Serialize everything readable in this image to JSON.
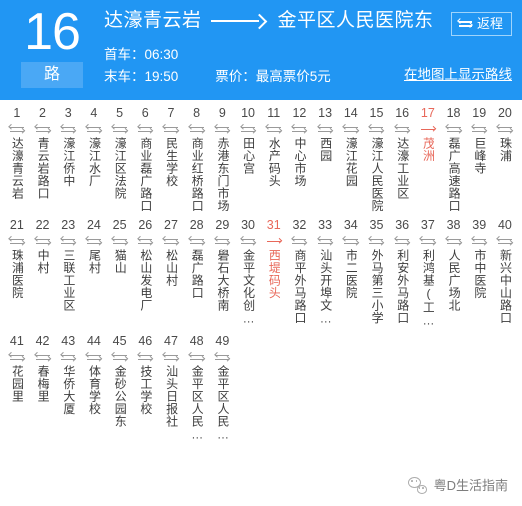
{
  "header": {
    "route_number": "16",
    "route_suffix": "路",
    "origin": "达濠青云岩",
    "destination": "金平区人民医院东",
    "direction_arrow_icon": "long-right-arrow-icon",
    "return_button_label": "返程",
    "return_button_icon": "swap-direction-icon",
    "first_bus_label": "首车：06:30",
    "last_bus_label": "末车：19:50",
    "fare_label": "票价：最高票价5元",
    "map_link_label": "在地图上显示路线",
    "background_color": "#2196f3",
    "badge_color": "#4aa8f5"
  },
  "highlight_color": "#e8685a",
  "stops": [
    {
      "num": "1",
      "name": "达濠青云岩",
      "highlight": false
    },
    {
      "num": "2",
      "name": "青云岩路口",
      "highlight": false
    },
    {
      "num": "3",
      "name": "濠江侨中",
      "highlight": false
    },
    {
      "num": "4",
      "name": "濠江水厂",
      "highlight": false
    },
    {
      "num": "5",
      "name": "濠江区法院",
      "highlight": false
    },
    {
      "num": "6",
      "name": "商业磊广路口",
      "highlight": false
    },
    {
      "num": "7",
      "name": "民生学校",
      "highlight": false
    },
    {
      "num": "8",
      "name": "商业红桥路口",
      "highlight": false
    },
    {
      "num": "9",
      "name": "赤港东门市场",
      "highlight": false
    },
    {
      "num": "10",
      "name": "田心宫",
      "highlight": false
    },
    {
      "num": "11",
      "name": "水产码头",
      "highlight": false
    },
    {
      "num": "12",
      "name": "中心市场",
      "highlight": false
    },
    {
      "num": "13",
      "name": "西园",
      "highlight": false
    },
    {
      "num": "14",
      "name": "濠江花园",
      "highlight": false
    },
    {
      "num": "15",
      "name": "濠江人民医院",
      "highlight": false
    },
    {
      "num": "16",
      "name": "达濠工业区",
      "highlight": false
    },
    {
      "num": "17",
      "name": "茂洲",
      "highlight": true
    },
    {
      "num": "18",
      "name": "磊广高速路口",
      "highlight": false
    },
    {
      "num": "19",
      "name": "巨峰寺",
      "highlight": false
    },
    {
      "num": "20",
      "name": "珠浦",
      "highlight": false
    },
    {
      "num": "21",
      "name": "珠浦医院",
      "highlight": false
    },
    {
      "num": "22",
      "name": "中村",
      "highlight": false
    },
    {
      "num": "23",
      "name": "三联工业区",
      "highlight": false
    },
    {
      "num": "24",
      "name": "尾村",
      "highlight": false
    },
    {
      "num": "25",
      "name": "猫山",
      "highlight": false
    },
    {
      "num": "26",
      "name": "松山发电厂",
      "highlight": false
    },
    {
      "num": "27",
      "name": "松山村",
      "highlight": false
    },
    {
      "num": "28",
      "name": "磊广路口",
      "highlight": false
    },
    {
      "num": "29",
      "name": "礐石大桥南",
      "highlight": false
    },
    {
      "num": "30",
      "name": "金平文化创…",
      "highlight": false
    },
    {
      "num": "31",
      "name": "西堤码头",
      "highlight": true
    },
    {
      "num": "32",
      "name": "商平外马路口",
      "highlight": false
    },
    {
      "num": "33",
      "name": "汕头开埠文…",
      "highlight": false
    },
    {
      "num": "34",
      "name": "市二医院",
      "highlight": false
    },
    {
      "num": "35",
      "name": "外马第三小学",
      "highlight": false
    },
    {
      "num": "36",
      "name": "利安外马路口",
      "highlight": false
    },
    {
      "num": "37",
      "name": "利鸿基(工…",
      "highlight": false
    },
    {
      "num": "38",
      "name": "人民广场北",
      "highlight": false
    },
    {
      "num": "39",
      "name": "市中医院",
      "highlight": false
    },
    {
      "num": "40",
      "name": "新兴中山路口",
      "highlight": false
    },
    {
      "num": "41",
      "name": "花园里",
      "highlight": false
    },
    {
      "num": "42",
      "name": "春梅里",
      "highlight": false
    },
    {
      "num": "43",
      "name": "华侨大厦",
      "highlight": false
    },
    {
      "num": "44",
      "name": "体育学校",
      "highlight": false
    },
    {
      "num": "45",
      "name": "金砂公园东",
      "highlight": false
    },
    {
      "num": "46",
      "name": "技工学校",
      "highlight": false
    },
    {
      "num": "47",
      "name": "汕头日报社",
      "highlight": false
    },
    {
      "num": "48",
      "name": "金平区人民…",
      "highlight": false
    },
    {
      "num": "49",
      "name": "金平区人民…",
      "highlight": false
    }
  ],
  "footer": {
    "icon": "wechat-icon",
    "account_name": "粤D生活指南"
  }
}
